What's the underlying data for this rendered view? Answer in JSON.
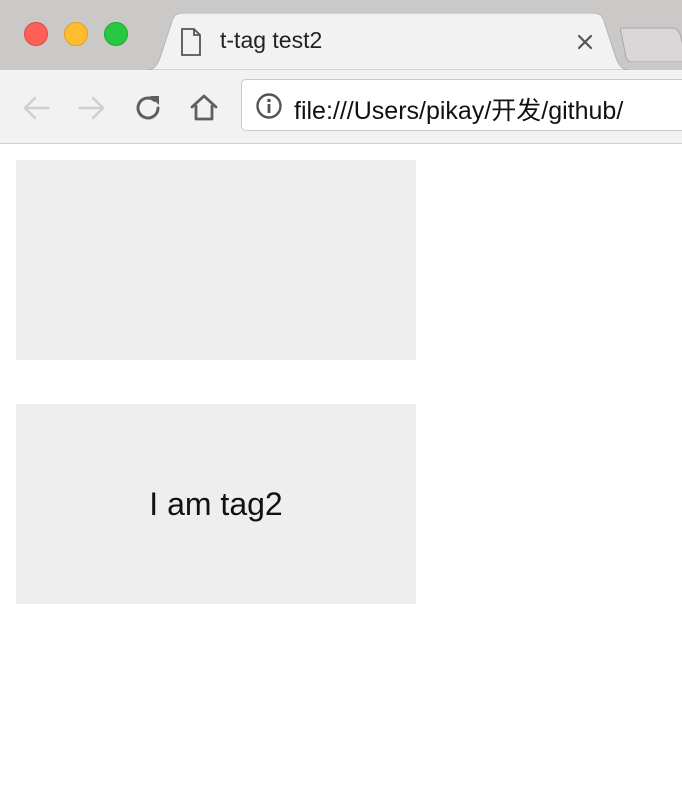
{
  "window": {
    "controls": [
      "close",
      "minimize",
      "zoom"
    ],
    "colors": {
      "close": "#fe5f57",
      "minimize": "#febc2e",
      "zoom": "#28c840"
    }
  },
  "tab": {
    "title": "t-tag test2",
    "icon": "page-icon",
    "close_icon": "close-icon"
  },
  "toolbar": {
    "back_icon": "arrow-left-icon",
    "forward_icon": "arrow-right-icon",
    "reload_icon": "reload-icon",
    "home_icon": "home-icon",
    "address": {
      "info_icon": "info-icon",
      "url": "file:///Users/pikay/开发/github/"
    }
  },
  "content": {
    "tags": [
      {
        "text": ""
      },
      {
        "text": "I am tag2"
      }
    ],
    "box_color": "#eeeeee"
  }
}
